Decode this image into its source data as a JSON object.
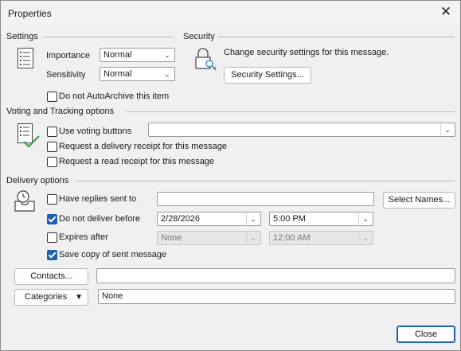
{
  "window": {
    "title": "Properties",
    "close_glyph": "✕"
  },
  "settings": {
    "heading": "Settings",
    "importance_label": "Importance",
    "importance_value": "Normal",
    "sensitivity_label": "Sensitivity",
    "sensitivity_value": "Normal",
    "no_autoarchive_label": "Do not AutoArchive this item",
    "no_autoarchive_checked": false,
    "icon": "list-icon"
  },
  "security": {
    "heading": "Security",
    "description": "Change security settings for this message.",
    "button_label": "Security Settings...",
    "icon": "lock-key-icon"
  },
  "voting": {
    "heading": "Voting and Tracking options",
    "use_voting_label": "Use voting buttons",
    "use_voting_checked": false,
    "voting_value": "",
    "delivery_receipt_label": "Request a delivery receipt for this message",
    "delivery_receipt_checked": false,
    "read_receipt_label": "Request a read receipt for this message",
    "read_receipt_checked": false,
    "icon": "checklist-icon"
  },
  "delivery": {
    "heading": "Delivery options",
    "replies_label": "Have replies sent to",
    "replies_checked": false,
    "replies_value": "",
    "select_names_label": "Select Names...",
    "do_not_deliver_label": "Do not deliver before",
    "do_not_deliver_checked": true,
    "deliver_date": "2/28/2026",
    "deliver_time": "5:00 PM",
    "expires_label": "Expires after",
    "expires_checked": false,
    "expires_date": "None",
    "expires_time": "12:00 AM",
    "save_copy_label": "Save copy of sent message",
    "save_copy_checked": true,
    "icon": "inbox-clock-icon"
  },
  "contacts": {
    "button_label": "Contacts...",
    "value": ""
  },
  "categories": {
    "button_label": "Categories",
    "value": "None"
  },
  "footer": {
    "close_label": "Close"
  },
  "colors": {
    "accent": "#1d61b0",
    "checkmark_green": "#2e9b46",
    "background": "#f0f0f0"
  }
}
